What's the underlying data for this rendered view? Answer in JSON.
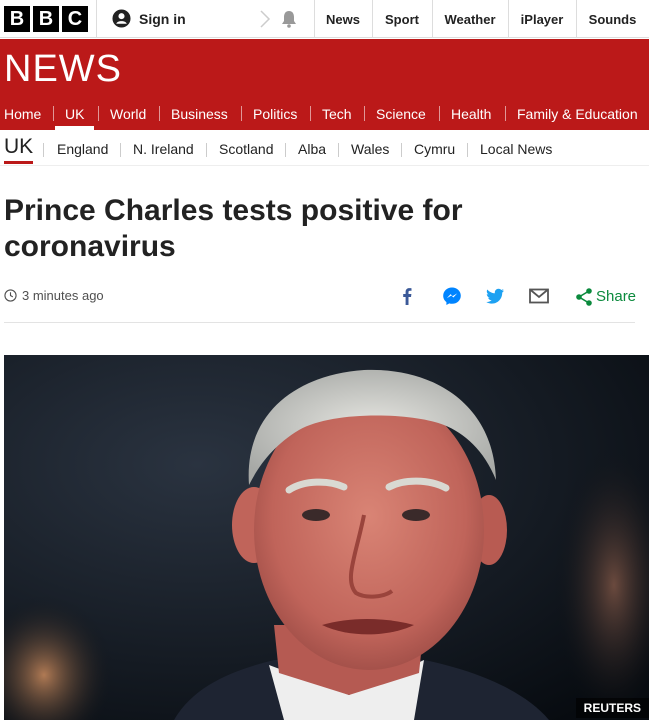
{
  "brand": {
    "letters": [
      "B",
      "B",
      "C"
    ]
  },
  "topbar": {
    "signin_label": "Sign in",
    "links": [
      "News",
      "Sport",
      "Weather",
      "iPlayer",
      "Sounds"
    ]
  },
  "section_title": "NEWS",
  "main_nav": {
    "items": [
      "Home",
      "UK",
      "World",
      "Business",
      "Politics",
      "Tech",
      "Science",
      "Health",
      "Family & Education"
    ],
    "active": "UK"
  },
  "sub_nav": {
    "current": "UK",
    "items": [
      "England",
      "N. Ireland",
      "Scotland",
      "Alba",
      "Wales",
      "Cymru",
      "Local News"
    ]
  },
  "article": {
    "headline": "Prince Charles tests positive for coronavirus",
    "timestamp": "3 minutes ago",
    "share_label": "Share",
    "photo_credit": "REUTERS"
  },
  "colors": {
    "brand_red": "#bb1919",
    "share_green": "#0b8a3d",
    "facebook": "#3b5998",
    "messenger": "#0084ff",
    "twitter": "#1da1f2"
  },
  "icons": [
    "user-icon",
    "chevron-right-icon",
    "bell-icon",
    "clock-icon",
    "facebook-icon",
    "messenger-icon",
    "twitter-icon",
    "email-icon",
    "share-icon"
  ]
}
